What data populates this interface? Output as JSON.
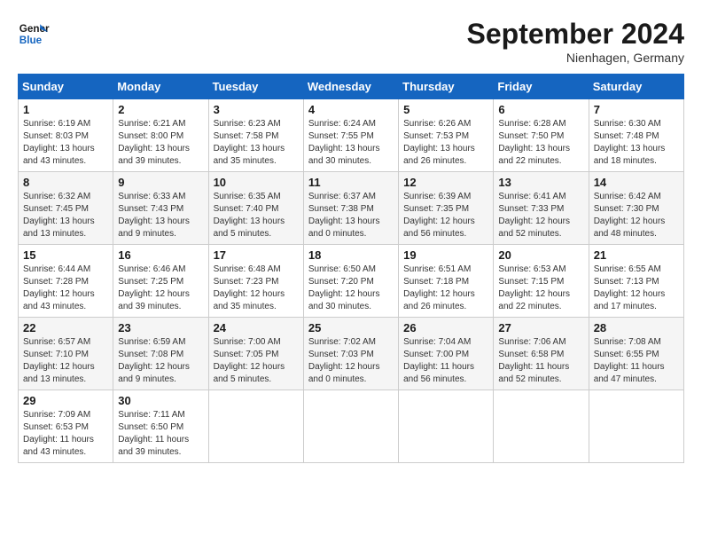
{
  "logo": {
    "line1": "General",
    "line2": "Blue"
  },
  "title": "September 2024",
  "location": "Nienhagen, Germany",
  "days_of_week": [
    "Sunday",
    "Monday",
    "Tuesday",
    "Wednesday",
    "Thursday",
    "Friday",
    "Saturday"
  ],
  "weeks": [
    [
      {
        "day": "1",
        "sunrise": "Sunrise: 6:19 AM",
        "sunset": "Sunset: 8:03 PM",
        "daylight": "Daylight: 13 hours and 43 minutes."
      },
      {
        "day": "2",
        "sunrise": "Sunrise: 6:21 AM",
        "sunset": "Sunset: 8:00 PM",
        "daylight": "Daylight: 13 hours and 39 minutes."
      },
      {
        "day": "3",
        "sunrise": "Sunrise: 6:23 AM",
        "sunset": "Sunset: 7:58 PM",
        "daylight": "Daylight: 13 hours and 35 minutes."
      },
      {
        "day": "4",
        "sunrise": "Sunrise: 6:24 AM",
        "sunset": "Sunset: 7:55 PM",
        "daylight": "Daylight: 13 hours and 30 minutes."
      },
      {
        "day": "5",
        "sunrise": "Sunrise: 6:26 AM",
        "sunset": "Sunset: 7:53 PM",
        "daylight": "Daylight: 13 hours and 26 minutes."
      },
      {
        "day": "6",
        "sunrise": "Sunrise: 6:28 AM",
        "sunset": "Sunset: 7:50 PM",
        "daylight": "Daylight: 13 hours and 22 minutes."
      },
      {
        "day": "7",
        "sunrise": "Sunrise: 6:30 AM",
        "sunset": "Sunset: 7:48 PM",
        "daylight": "Daylight: 13 hours and 18 minutes."
      }
    ],
    [
      {
        "day": "8",
        "sunrise": "Sunrise: 6:32 AM",
        "sunset": "Sunset: 7:45 PM",
        "daylight": "Daylight: 13 hours and 13 minutes."
      },
      {
        "day": "9",
        "sunrise": "Sunrise: 6:33 AM",
        "sunset": "Sunset: 7:43 PM",
        "daylight": "Daylight: 13 hours and 9 minutes."
      },
      {
        "day": "10",
        "sunrise": "Sunrise: 6:35 AM",
        "sunset": "Sunset: 7:40 PM",
        "daylight": "Daylight: 13 hours and 5 minutes."
      },
      {
        "day": "11",
        "sunrise": "Sunrise: 6:37 AM",
        "sunset": "Sunset: 7:38 PM",
        "daylight": "Daylight: 13 hours and 0 minutes."
      },
      {
        "day": "12",
        "sunrise": "Sunrise: 6:39 AM",
        "sunset": "Sunset: 7:35 PM",
        "daylight": "Daylight: 12 hours and 56 minutes."
      },
      {
        "day": "13",
        "sunrise": "Sunrise: 6:41 AM",
        "sunset": "Sunset: 7:33 PM",
        "daylight": "Daylight: 12 hours and 52 minutes."
      },
      {
        "day": "14",
        "sunrise": "Sunrise: 6:42 AM",
        "sunset": "Sunset: 7:30 PM",
        "daylight": "Daylight: 12 hours and 48 minutes."
      }
    ],
    [
      {
        "day": "15",
        "sunrise": "Sunrise: 6:44 AM",
        "sunset": "Sunset: 7:28 PM",
        "daylight": "Daylight: 12 hours and 43 minutes."
      },
      {
        "day": "16",
        "sunrise": "Sunrise: 6:46 AM",
        "sunset": "Sunset: 7:25 PM",
        "daylight": "Daylight: 12 hours and 39 minutes."
      },
      {
        "day": "17",
        "sunrise": "Sunrise: 6:48 AM",
        "sunset": "Sunset: 7:23 PM",
        "daylight": "Daylight: 12 hours and 35 minutes."
      },
      {
        "day": "18",
        "sunrise": "Sunrise: 6:50 AM",
        "sunset": "Sunset: 7:20 PM",
        "daylight": "Daylight: 12 hours and 30 minutes."
      },
      {
        "day": "19",
        "sunrise": "Sunrise: 6:51 AM",
        "sunset": "Sunset: 7:18 PM",
        "daylight": "Daylight: 12 hours and 26 minutes."
      },
      {
        "day": "20",
        "sunrise": "Sunrise: 6:53 AM",
        "sunset": "Sunset: 7:15 PM",
        "daylight": "Daylight: 12 hours and 22 minutes."
      },
      {
        "day": "21",
        "sunrise": "Sunrise: 6:55 AM",
        "sunset": "Sunset: 7:13 PM",
        "daylight": "Daylight: 12 hours and 17 minutes."
      }
    ],
    [
      {
        "day": "22",
        "sunrise": "Sunrise: 6:57 AM",
        "sunset": "Sunset: 7:10 PM",
        "daylight": "Daylight: 12 hours and 13 minutes."
      },
      {
        "day": "23",
        "sunrise": "Sunrise: 6:59 AM",
        "sunset": "Sunset: 7:08 PM",
        "daylight": "Daylight: 12 hours and 9 minutes."
      },
      {
        "day": "24",
        "sunrise": "Sunrise: 7:00 AM",
        "sunset": "Sunset: 7:05 PM",
        "daylight": "Daylight: 12 hours and 5 minutes."
      },
      {
        "day": "25",
        "sunrise": "Sunrise: 7:02 AM",
        "sunset": "Sunset: 7:03 PM",
        "daylight": "Daylight: 12 hours and 0 minutes."
      },
      {
        "day": "26",
        "sunrise": "Sunrise: 7:04 AM",
        "sunset": "Sunset: 7:00 PM",
        "daylight": "Daylight: 11 hours and 56 minutes."
      },
      {
        "day": "27",
        "sunrise": "Sunrise: 7:06 AM",
        "sunset": "Sunset: 6:58 PM",
        "daylight": "Daylight: 11 hours and 52 minutes."
      },
      {
        "day": "28",
        "sunrise": "Sunrise: 7:08 AM",
        "sunset": "Sunset: 6:55 PM",
        "daylight": "Daylight: 11 hours and 47 minutes."
      }
    ],
    [
      {
        "day": "29",
        "sunrise": "Sunrise: 7:09 AM",
        "sunset": "Sunset: 6:53 PM",
        "daylight": "Daylight: 11 hours and 43 minutes."
      },
      {
        "day": "30",
        "sunrise": "Sunrise: 7:11 AM",
        "sunset": "Sunset: 6:50 PM",
        "daylight": "Daylight: 11 hours and 39 minutes."
      },
      null,
      null,
      null,
      null,
      null
    ]
  ]
}
